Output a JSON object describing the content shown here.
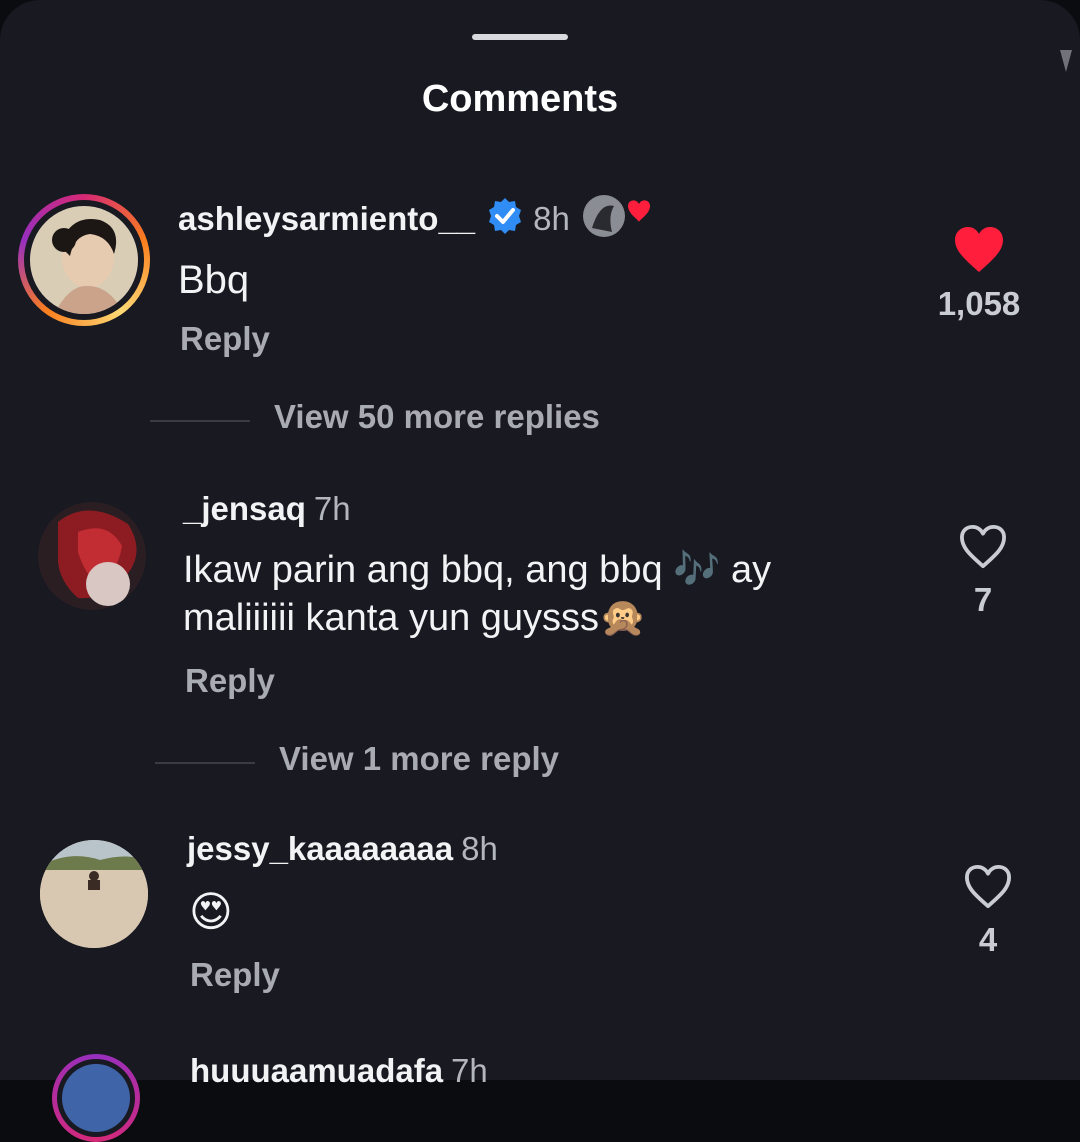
{
  "sheet": {
    "title": "Comments"
  },
  "comments": [
    {
      "username": "ashleysarmiento__",
      "verified": true,
      "time": "8h",
      "text": "Bbq",
      "reply_label": "Reply",
      "likes": "1,058",
      "liked": true,
      "view_replies": "View 50 more replies"
    },
    {
      "username": "_jensaq",
      "time": "7h",
      "text_line1": "Ikaw parin ang bbq, ang bbq",
      "text_emoji1": "🎶",
      "text_line1b": " ay",
      "text_line2": "maliiiiii kanta yun guysss",
      "text_emoji2": "🙊",
      "reply_label": "Reply",
      "likes": "7",
      "liked": false,
      "view_replies": "View 1 more reply"
    },
    {
      "username": "jessy_kaaaaaaaa",
      "time": "8h",
      "text": "😍",
      "reply_label": "Reply",
      "likes": "4",
      "liked": false
    },
    {
      "username": "huuuaamuadafa",
      "time": "7h"
    }
  ],
  "colors": {
    "background": "#181921",
    "like_red": "#ff1f3d",
    "verified_blue": "#2f8df5"
  }
}
